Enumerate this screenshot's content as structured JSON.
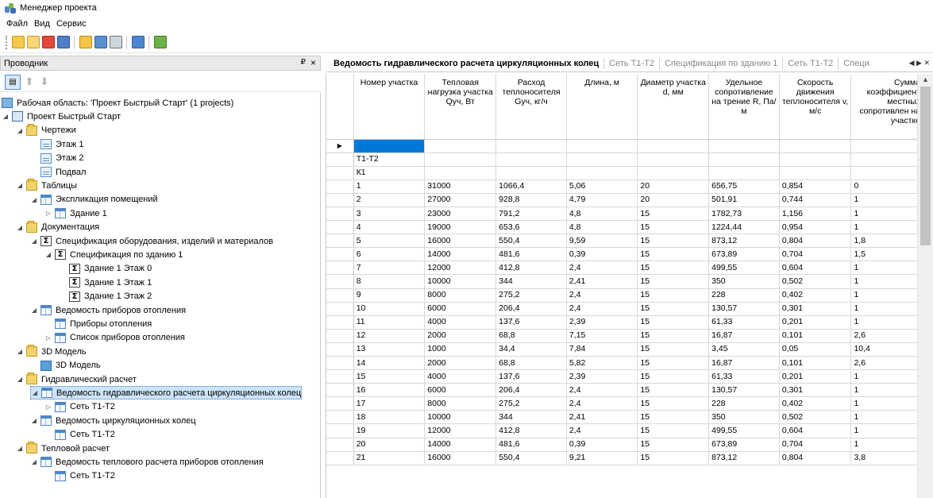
{
  "window": {
    "title": "Менеджер проекта"
  },
  "menu": [
    "Файл",
    "Вид",
    "Сервис"
  ],
  "toolbar_icons": [
    "new-icon",
    "open-icon",
    "close-icon",
    "save-icon",
    "properties-icon",
    "settings-icon",
    "print-icon",
    "export-icon",
    "plugin-icon"
  ],
  "explorer": {
    "title": "Проводник",
    "pin": "₽",
    "close": "×",
    "tree": [
      {
        "label": "Рабочая область: 'Проект Быстрый Старт' (1 projects)",
        "level": 0,
        "icon": "workspace",
        "expander": "none"
      },
      {
        "label": "Проект Быстрый Старт",
        "level": 0,
        "icon": "project",
        "expander": "open"
      },
      {
        "label": "Чертежи",
        "level": 1,
        "icon": "folder",
        "expander": "open"
      },
      {
        "label": "Этаж 1",
        "level": 2,
        "icon": "doc",
        "expander": "none"
      },
      {
        "label": "Этаж 2",
        "level": 2,
        "icon": "doc",
        "expander": "none"
      },
      {
        "label": "Подвал",
        "level": 2,
        "icon": "doc",
        "expander": "none"
      },
      {
        "label": "Таблицы",
        "level": 1,
        "icon": "folder",
        "expander": "open"
      },
      {
        "label": "Экспликация помещений",
        "level": 2,
        "icon": "table",
        "expander": "open"
      },
      {
        "label": "Здание 1",
        "level": 3,
        "icon": "table",
        "expander": "closed"
      },
      {
        "label": "Документация",
        "level": 1,
        "icon": "folder",
        "expander": "open"
      },
      {
        "label": "Спецификация оборудования, изделий и материалов",
        "level": 2,
        "icon": "sigma",
        "expander": "open"
      },
      {
        "label": "Спецификация по зданию 1",
        "level": 3,
        "icon": "sigma",
        "expander": "open"
      },
      {
        "label": "Здание 1 Этаж 0",
        "level": 4,
        "icon": "sigma",
        "expander": "none"
      },
      {
        "label": "Здание 1 Этаж 1",
        "level": 4,
        "icon": "sigma",
        "expander": "none"
      },
      {
        "label": "Здание 1 Этаж 2",
        "level": 4,
        "icon": "sigma",
        "expander": "none"
      },
      {
        "label": "Ведомость приборов отопления",
        "level": 2,
        "icon": "table",
        "expander": "open"
      },
      {
        "label": "Приборы отопления",
        "level": 3,
        "icon": "table",
        "expander": "none"
      },
      {
        "label": "Список приборов отопления",
        "level": 3,
        "icon": "table",
        "expander": "closed"
      },
      {
        "label": "3D Модель",
        "level": 1,
        "icon": "folder",
        "expander": "open"
      },
      {
        "label": "3D Модель",
        "level": 2,
        "icon": "cube",
        "expander": "none"
      },
      {
        "label": "Гидравлический расчет",
        "level": 1,
        "icon": "folder",
        "expander": "open"
      },
      {
        "label": "Ведомость гидравлического расчета циркуляционных колец",
        "level": 2,
        "icon": "table",
        "expander": "open",
        "selected": true
      },
      {
        "label": "Сеть Т1-Т2",
        "level": 3,
        "icon": "table",
        "expander": "closed"
      },
      {
        "label": "Ведомость циркуляционных колец",
        "level": 2,
        "icon": "table",
        "expander": "open"
      },
      {
        "label": "Сеть Т1-Т2",
        "level": 3,
        "icon": "table",
        "expander": "none"
      },
      {
        "label": "Тепловой расчет",
        "level": 1,
        "icon": "folder",
        "expander": "open"
      },
      {
        "label": "Ведомость теплового расчета приборов отопления",
        "level": 2,
        "icon": "table",
        "expander": "open"
      },
      {
        "label": "Сеть Т1-Т2",
        "level": 3,
        "icon": "table",
        "expander": "none"
      }
    ]
  },
  "tabs": [
    {
      "label": "Ведомость гидравлического расчета циркуляционных колец",
      "active": true
    },
    {
      "label": "Сеть Т1-Т2",
      "active": false
    },
    {
      "label": "Спецификация по зданию 1",
      "active": false
    },
    {
      "label": "Сеть Т1-Т2",
      "active": false
    },
    {
      "label": "Специ",
      "active": false
    }
  ],
  "tab_nav": "◀ ▶ ✕",
  "grid": {
    "columns": [
      "Номер участка",
      "Тепловая нагрузка участка Qуч, Вт",
      "Расход теплоносителя Gуч, кг/ч",
      "Длина, м",
      "Диаметр участка d, мм",
      "Удельное сопротивление на трение R, Па/м",
      "Скорость движения теплоносителя v, м/с",
      "Сумма коэффициент местных сопротивлен на участке"
    ],
    "rows": [
      [
        "",
        "",
        "",
        "",
        "",
        "",
        "",
        ""
      ],
      [
        "Т1-Т2",
        "",
        "",
        "",
        "",
        "",
        "",
        ""
      ],
      [
        "К1",
        "",
        "",
        "",
        "",
        "",
        "",
        ""
      ],
      [
        "1",
        "31000",
        "1066,4",
        "5,06",
        "20",
        "656,75",
        "0,854",
        "0"
      ],
      [
        "2",
        "27000",
        "928,8",
        "4,79",
        "20",
        "501,91",
        "0,744",
        "1"
      ],
      [
        "3",
        "23000",
        "791,2",
        "4,8",
        "15",
        "1782,73",
        "1,156",
        "1"
      ],
      [
        "4",
        "19000",
        "653,6",
        "4,8",
        "15",
        "1224,44",
        "0,954",
        "1"
      ],
      [
        "5",
        "16000",
        "550,4",
        "9,59",
        "15",
        "873,12",
        "0,804",
        "1,8"
      ],
      [
        "6",
        "14000",
        "481,6",
        "0,39",
        "15",
        "673,89",
        "0,704",
        "1,5"
      ],
      [
        "7",
        "12000",
        "412,8",
        "2,4",
        "15",
        "499,55",
        "0,604",
        "1"
      ],
      [
        "8",
        "10000",
        "344",
        "2,41",
        "15",
        "350",
        "0,502",
        "1"
      ],
      [
        "9",
        "8000",
        "275,2",
        "2,4",
        "15",
        "228",
        "0,402",
        "1"
      ],
      [
        "10",
        "6000",
        "206,4",
        "2,4",
        "15",
        "130,57",
        "0,301",
        "1"
      ],
      [
        "11",
        "4000",
        "137,6",
        "2,39",
        "15",
        "61,33",
        "0,201",
        "1"
      ],
      [
        "12",
        "2000",
        "68,8",
        "7,15",
        "15",
        "16,87",
        "0,101",
        "2,6"
      ],
      [
        "13",
        "1000",
        "34,4",
        "7,84",
        "15",
        "3,45",
        "0,05",
        "10,4"
      ],
      [
        "14",
        "2000",
        "68,8",
        "5,82",
        "15",
        "16,87",
        "0,101",
        "2,6"
      ],
      [
        "15",
        "4000",
        "137,6",
        "2,39",
        "15",
        "61,33",
        "0,201",
        "1"
      ],
      [
        "16",
        "6000",
        "206,4",
        "2,4",
        "15",
        "130,57",
        "0,301",
        "1"
      ],
      [
        "17",
        "8000",
        "275,2",
        "2,4",
        "15",
        "228",
        "0,402",
        "1"
      ],
      [
        "18",
        "10000",
        "344",
        "2,41",
        "15",
        "350",
        "0,502",
        "1"
      ],
      [
        "19",
        "12000",
        "412,8",
        "2,4",
        "15",
        "499,55",
        "0,604",
        "1"
      ],
      [
        "20",
        "14000",
        "481,6",
        "0,39",
        "15",
        "673,89",
        "0,704",
        "1"
      ],
      [
        "21",
        "16000",
        "550,4",
        "9,21",
        "15",
        "873,12",
        "0,804",
        "3,8"
      ]
    ]
  }
}
